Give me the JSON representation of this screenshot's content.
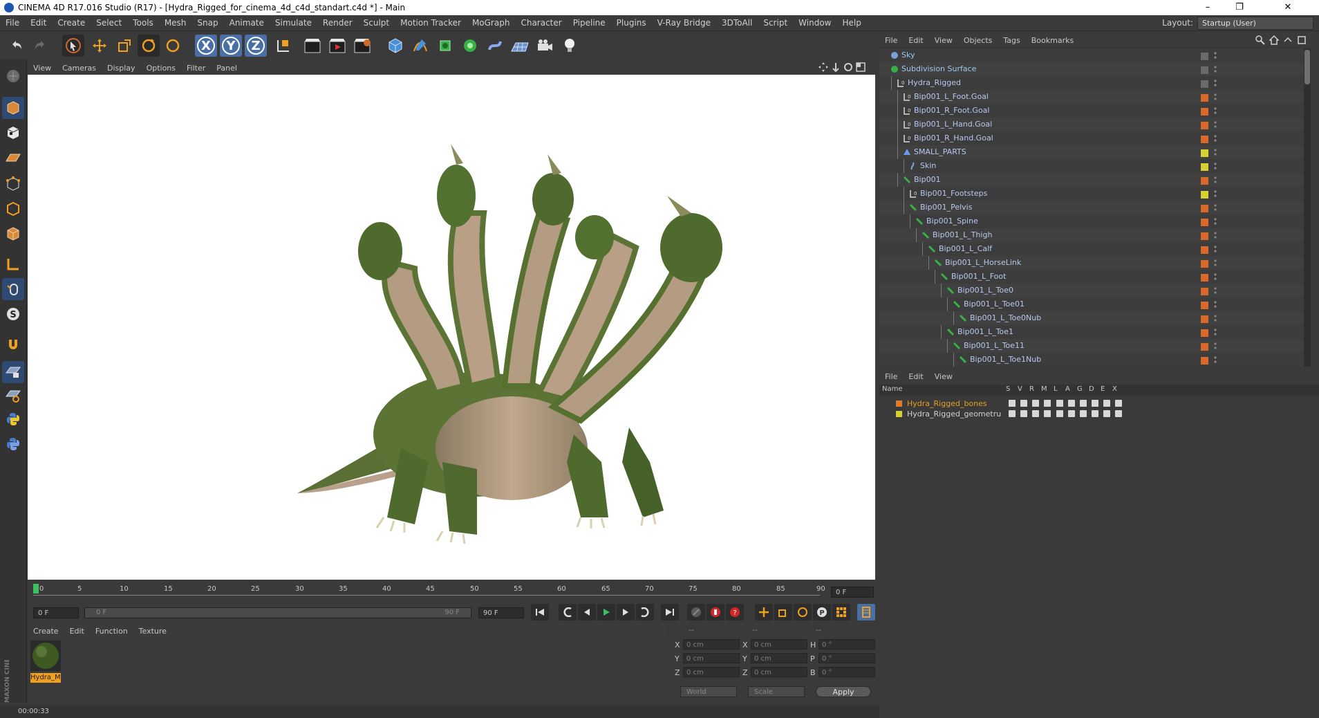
{
  "window": {
    "title": "CINEMA 4D R17.016 Studio (R17) - [Hydra_Rigged_for_cinema_4d_c4d_standart.c4d *] - Main",
    "minimize": "–",
    "restore": "❐",
    "close": "✕"
  },
  "menubar": {
    "items": [
      "File",
      "Edit",
      "Create",
      "Select",
      "Tools",
      "Mesh",
      "Snap",
      "Animate",
      "Simulate",
      "Render",
      "Sculpt",
      "Motion Tracker",
      "MoGraph",
      "Character",
      "Pipeline",
      "Plugins",
      "V-Ray Bridge",
      "3DToAll",
      "Script",
      "Window",
      "Help"
    ],
    "layout_label": "Layout:",
    "layout_value": "Startup (User)"
  },
  "toolbar": {
    "axis_x": "X",
    "axis_y": "Y",
    "axis_z": "Z"
  },
  "viewport": {
    "menu": [
      "View",
      "Cameras",
      "Display",
      "Options",
      "Filter",
      "Panel"
    ]
  },
  "timeline": {
    "ticks": [
      "0",
      "5",
      "10",
      "15",
      "20",
      "25",
      "30",
      "35",
      "40",
      "45",
      "50",
      "55",
      "60",
      "65",
      "70",
      "75",
      "80",
      "85",
      "90"
    ],
    "current_frame": "0 F",
    "start_field": "0 F",
    "range_start": "0 F",
    "range_end": "90 F",
    "end_field": "90 F"
  },
  "material_manager": {
    "menu": [
      "Create",
      "Edit",
      "Function",
      "Texture"
    ],
    "material_name": "Hydra_M"
  },
  "coordinates": {
    "headers": [
      "--",
      "--",
      "--"
    ],
    "rows": [
      {
        "l1": "X",
        "v1": "0 cm",
        "l2": "X",
        "v2": "0 cm",
        "l3": "H",
        "v3": "0 °"
      },
      {
        "l1": "Y",
        "v1": "0 cm",
        "l2": "Y",
        "v2": "0 cm",
        "l3": "P",
        "v3": "0 °"
      },
      {
        "l1": "Z",
        "v1": "0 cm",
        "l2": "Z",
        "v2": "0 cm",
        "l3": "B",
        "v3": "0 °"
      }
    ],
    "world_select": "World",
    "scale_select": "Scale",
    "apply_label": "Apply"
  },
  "status": {
    "time": "00:00:33"
  },
  "brand": {
    "vertical_text": "MAXON CINEMA 4D"
  },
  "object_manager": {
    "menu": [
      "File",
      "Edit",
      "View",
      "Objects",
      "Tags",
      "Bookmarks"
    ],
    "rows": [
      {
        "name": "Sky",
        "icon": "sky",
        "tag": "gray"
      },
      {
        "name": "Subdivision Surface",
        "icon": "subdiv",
        "tag": "gray"
      },
      {
        "name": "Hydra_Rigged",
        "icon": "null",
        "tag": "gray"
      },
      {
        "name": "Bip001_L_Foot.Goal",
        "icon": "null",
        "tag": "orange"
      },
      {
        "name": "Bip001_R_Foot.Goal",
        "icon": "null",
        "tag": "orange"
      },
      {
        "name": "Bip001_L_Hand.Goal",
        "icon": "null",
        "tag": "orange"
      },
      {
        "name": "Bip001_R_Hand.Goal",
        "icon": "null",
        "tag": "orange"
      },
      {
        "name": "SMALL_PARTS",
        "icon": "poly",
        "tag": "yellow"
      },
      {
        "name": "Skin",
        "icon": "skin",
        "tag": "yellow"
      },
      {
        "name": "Bip001",
        "icon": "bone",
        "tag": "orange"
      },
      {
        "name": "Bip001_Footsteps",
        "icon": "null",
        "tag": "yellow"
      },
      {
        "name": "Bip001_Pelvis",
        "icon": "bone",
        "tag": "orange"
      },
      {
        "name": "Bip001_Spine",
        "icon": "bone",
        "tag": "orange"
      },
      {
        "name": "Bip001_L_Thigh",
        "icon": "bone",
        "tag": "orange"
      },
      {
        "name": "Bip001_L_Calf",
        "icon": "bone",
        "tag": "orange"
      },
      {
        "name": "Bip001_L_HorseLink",
        "icon": "bone",
        "tag": "orange"
      },
      {
        "name": "Bip001_L_Foot",
        "icon": "bone",
        "tag": "orange"
      },
      {
        "name": "Bip001_L_Toe0",
        "icon": "bone",
        "tag": "orange"
      },
      {
        "name": "Bip001_L_Toe01",
        "icon": "bone",
        "tag": "orange"
      },
      {
        "name": "Bip001_L_Toe0Nub",
        "icon": "bone",
        "tag": "orange"
      },
      {
        "name": "Bip001_L_Toe1",
        "icon": "bone",
        "tag": "orange"
      },
      {
        "name": "Bip001_L_Toe11",
        "icon": "bone",
        "tag": "orange"
      },
      {
        "name": "Bip001_L_Toe1Nub",
        "icon": "bone",
        "tag": "orange"
      }
    ]
  },
  "layer_manager": {
    "menu": [
      "File",
      "Edit",
      "View"
    ],
    "columns": [
      "Name",
      "S",
      "V",
      "R",
      "M",
      "L",
      "A",
      "G",
      "D",
      "E",
      "X"
    ],
    "layers": [
      {
        "name": "Hydra_Rigged_bones",
        "color": "#e07b2a",
        "text_color": "#e8a020"
      },
      {
        "name": "Hydra_Rigged_geometru",
        "color": "#d8d030",
        "text_color": "#d0d0d0"
      }
    ]
  },
  "colors": {
    "accent_blue": "#4a6fa5",
    "tag_orange": "#d9692a",
    "tag_yellow": "#d8d030",
    "object_text": "#b8c8f0"
  }
}
